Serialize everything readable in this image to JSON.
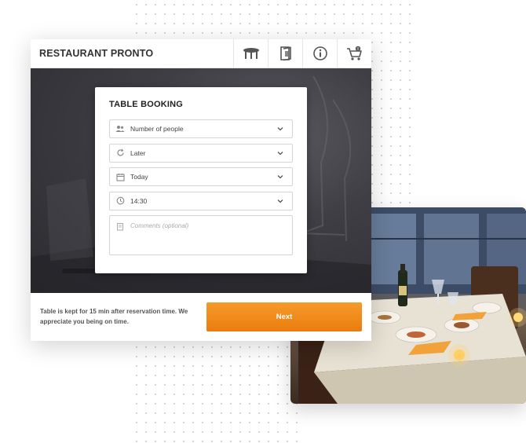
{
  "header": {
    "title": "RESTAURANT PRONTO",
    "icons": [
      "table-icon",
      "menu-book-icon",
      "info-icon",
      "cart-icon"
    ]
  },
  "booking": {
    "title": "TABLE BOOKING",
    "fields": [
      {
        "icon": "people-icon",
        "value": "Number of people"
      },
      {
        "icon": "refresh-icon",
        "value": "Later"
      },
      {
        "icon": "calendar-icon",
        "value": "Today"
      },
      {
        "icon": "clock-icon",
        "value": "14:30"
      }
    ],
    "comments_placeholder": "Comments (optional)"
  },
  "footer": {
    "note": "Table is kept for 15 min after reservation time. We appreciate you being on time.",
    "next_label": "Next"
  },
  "colors": {
    "accent": "#F08A1C",
    "hero_bg": "#3A3A40"
  }
}
